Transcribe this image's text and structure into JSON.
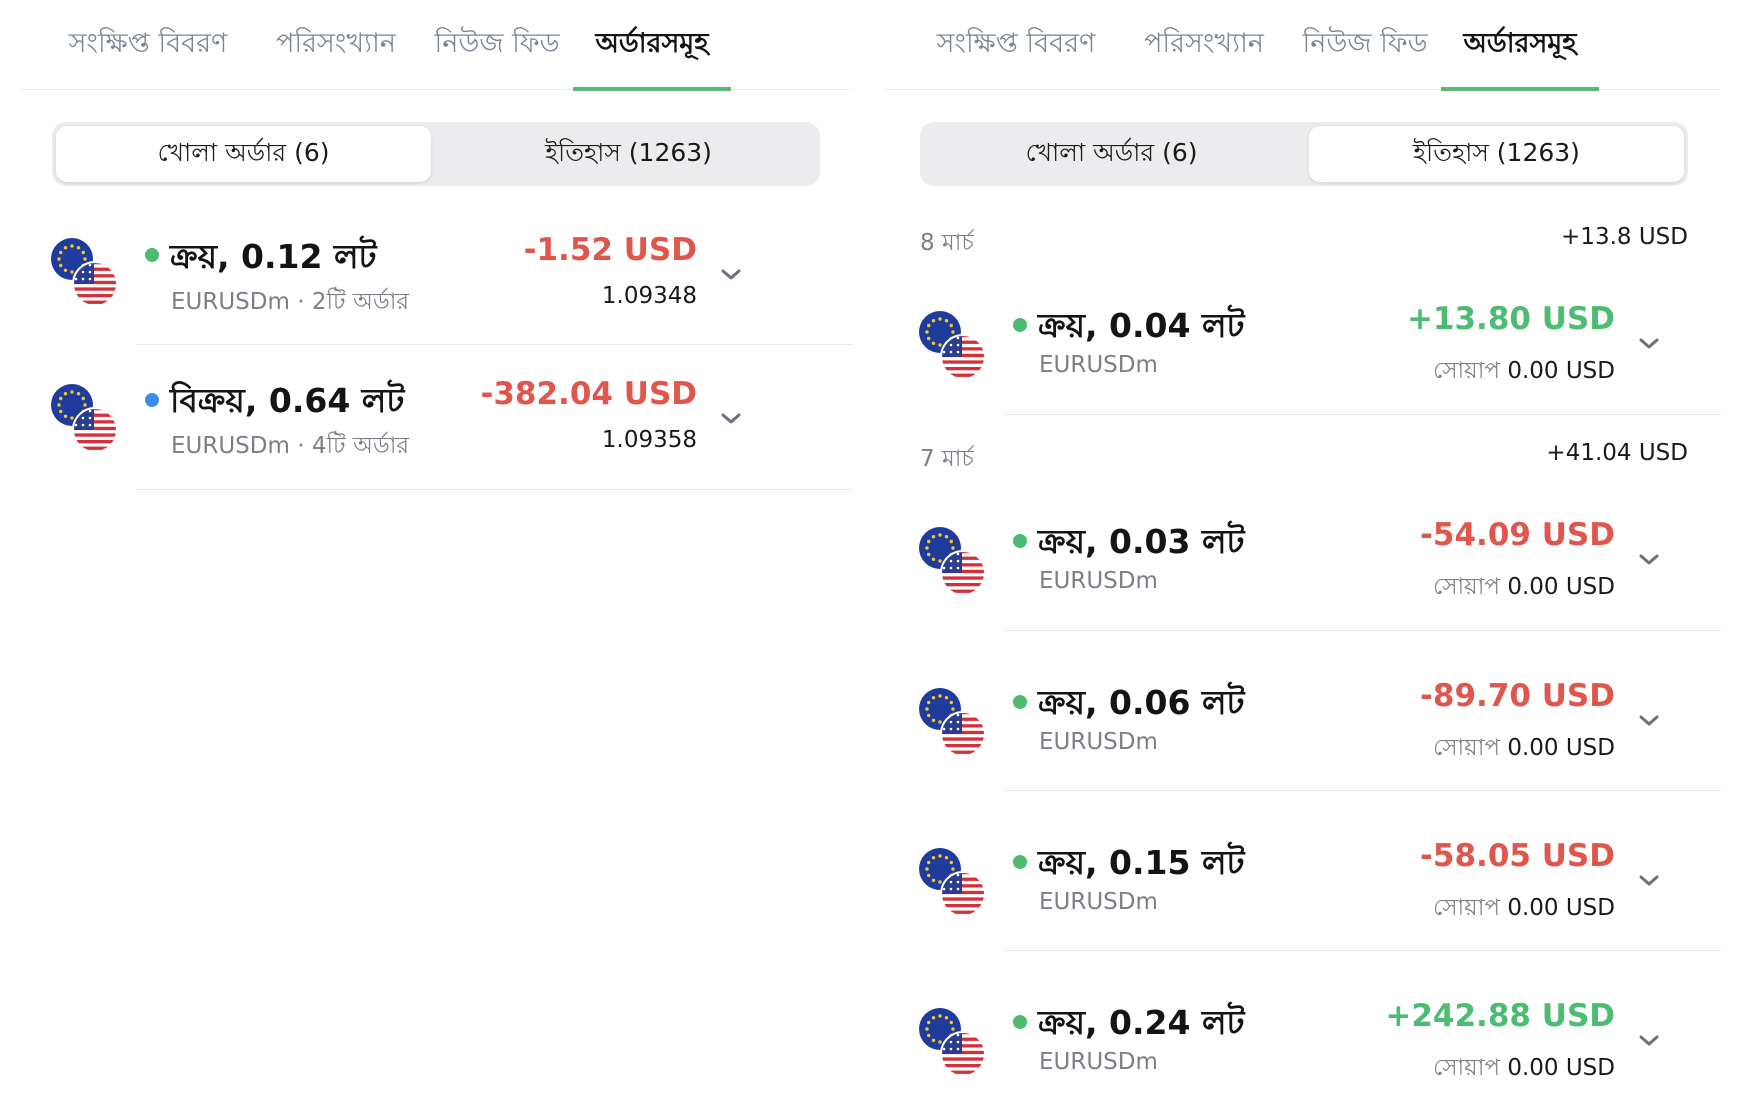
{
  "tabs": [
    "সংক্ষিপ্ত বিবরণ",
    "পরিসংখ্যান",
    "নিউজ ফিড",
    "অর্ডারসমূহ"
  ],
  "active_tab": "অর্ডারসমূহ",
  "segment": {
    "open": "খোলা অর্ডার (6)",
    "history": "ইতিহাস (1263)"
  },
  "left_panel": {
    "selected_segment": "open",
    "orders": [
      {
        "direction": "buy",
        "dot_color": "#4cbc72",
        "title": "ক্রয়, 0.12 লট",
        "symbol": "EURUSDm",
        "count": "· 2টি অর্ডার",
        "amount": "-1.52 USD",
        "price": "1.09348"
      },
      {
        "direction": "sell",
        "dot_color": "#3f8cf0",
        "title": "বিক্রয়, 0.64 লট",
        "symbol": "EURUSDm",
        "count": "· 4টি অর্ডার",
        "amount": "-382.04 USD",
        "price": "1.09358"
      }
    ]
  },
  "right_panel": {
    "selected_segment": "history",
    "groups": [
      {
        "date": "8 মার্চ",
        "total": "+13.8 USD",
        "items": [
          {
            "title": "ক্রয়, 0.04 লট",
            "symbol": "EURUSDm",
            "amount": "+13.80 USD",
            "swap_label": "সোয়াপ",
            "swap_value": "0.00 USD"
          }
        ]
      },
      {
        "date": "7 মার্চ",
        "total": "+41.04 USD",
        "items": [
          {
            "title": "ক্রয়, 0.03 লট",
            "symbol": "EURUSDm",
            "amount": "-54.09 USD",
            "swap_label": "সোয়াপ",
            "swap_value": "0.00 USD"
          },
          {
            "title": "ক্রয়, 0.06 লট",
            "symbol": "EURUSDm",
            "amount": "-89.70 USD",
            "swap_label": "সোয়াপ",
            "swap_value": "0.00 USD"
          },
          {
            "title": "ক্রয়, 0.15 লট",
            "symbol": "EURUSDm",
            "amount": "-58.05 USD",
            "swap_label": "সোয়াপ",
            "swap_value": "0.00 USD"
          },
          {
            "title": "ক্রয়, 0.24 লট",
            "symbol": "EURUSDm",
            "amount": "+242.88 USD",
            "swap_label": "সোয়াপ",
            "swap_value": "0.00 USD"
          }
        ]
      }
    ]
  },
  "icons": {
    "flag": "eur-usd-flag-icon",
    "chevron": "chevron-down-icon"
  },
  "colors": {
    "accent": "#56b97a",
    "positive": "#4cbc72",
    "negative": "#e0554c",
    "sell_dot": "#3f8cf0"
  }
}
